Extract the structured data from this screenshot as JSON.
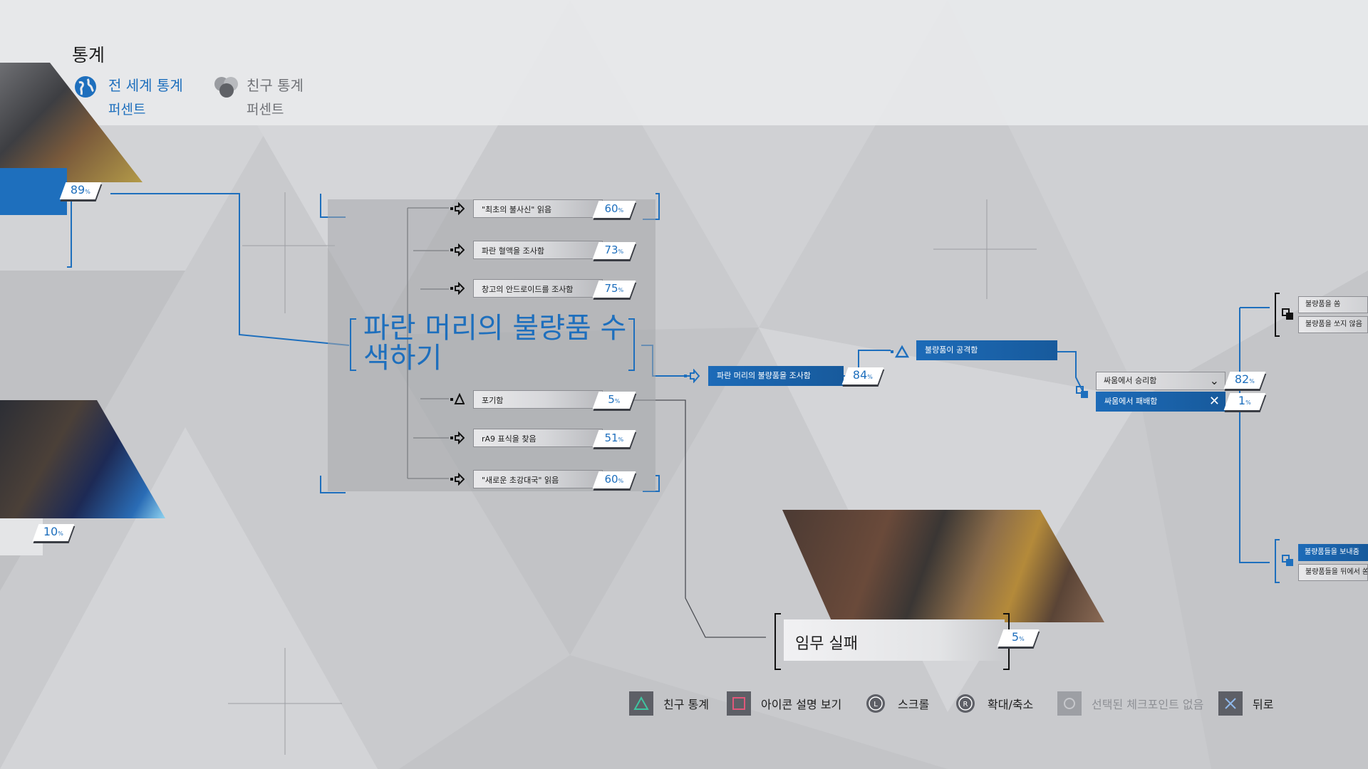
{
  "header": {
    "title": "통계",
    "tabs": [
      {
        "label": "전 세계 통계",
        "sub": "퍼센트",
        "active": true,
        "icon": "globe-icon"
      },
      {
        "label": "친구 통계",
        "sub": "퍼센트",
        "active": false,
        "icon": "friends-icon"
      }
    ]
  },
  "left_panel": {
    "top_percent": "89",
    "bottom_percent": "10"
  },
  "node": {
    "title": "파란 머리의 불량품 수색하기",
    "choices": [
      {
        "label": "\"최초의 불사신\" 읽음",
        "percent": "60",
        "icon": "arrow-icon"
      },
      {
        "label": "파란 혈액을 조사함",
        "percent": "73",
        "icon": "arrow-icon"
      },
      {
        "label": "창고의 안드로이드를 조사함",
        "percent": "75",
        "icon": "arrow-icon"
      },
      {
        "label": "포기함",
        "percent": "5",
        "icon": "triangle-icon"
      },
      {
        "label": "rA9 표식을 찾음",
        "percent": "51",
        "icon": "arrow-icon"
      },
      {
        "label": "\"새로운 초강대국\" 읽음",
        "percent": "60",
        "icon": "arrow-icon"
      }
    ]
  },
  "path": {
    "investigate": {
      "label": "파란 머리의 불량품을 조사함",
      "percent": "84"
    },
    "attacked": {
      "label": "불량품이 공격함"
    },
    "fight": [
      {
        "label": "싸움에서 승리함",
        "percent": "82",
        "icon": "chevron-down-icon"
      },
      {
        "label": "싸움에서 패배함",
        "percent": "1",
        "icon": "x-icon"
      }
    ],
    "right_top": [
      "불량품을 쏨",
      "불량품을 쏘지 않음"
    ],
    "right_bottom": [
      "불량품들을 보내줌",
      "불량품들을 뒤에서 쏨"
    ]
  },
  "failure": {
    "label": "임무 실패",
    "percent": "5"
  },
  "percent_unit": "%",
  "footer": [
    {
      "label": "친구 통계",
      "icon": "triangle-button-icon",
      "dim": false
    },
    {
      "label": "아이콘 설명 보기",
      "icon": "square-button-icon",
      "dim": false
    },
    {
      "label": "스크롤",
      "icon": "left-stick-icon",
      "dim": false
    },
    {
      "label": "확대/축소",
      "icon": "right-stick-icon",
      "dim": false
    },
    {
      "label": "선택된 체크포인트 없음",
      "icon": "circle-button-icon",
      "dim": true
    },
    {
      "label": "뒤로",
      "icon": "cross-button-icon",
      "dim": false
    }
  ],
  "colors": {
    "accent": "#1e6fbd",
    "selected_bar": "#1d6bb8",
    "background": "#c9cacd"
  }
}
